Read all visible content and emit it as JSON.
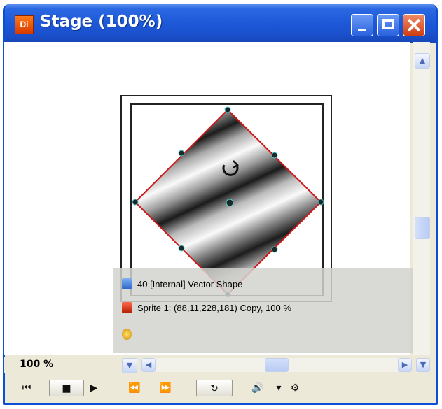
{
  "window": {
    "app_icon_text": "Di",
    "title": "Stage (100%)"
  },
  "info": {
    "line1": "40 [Internal] Vector Shape",
    "line2": "Sprite 1: (88,11,228,181) Copy, 100 %"
  },
  "status": {
    "zoom": "100 %"
  },
  "icons": {
    "minimize": "minimize-icon",
    "maximize": "maximize-icon",
    "close": "close-icon",
    "rotate": "rotate-icon",
    "rewind": "rewind-icon",
    "stop": "stop-icon",
    "play": "play-icon",
    "step_back": "step-back-icon",
    "step_forward": "step-forward-icon",
    "loop": "loop-icon",
    "volume": "volume-icon",
    "dtv": "dtv-icon"
  },
  "colors": {
    "title_bar": "#1d58d8",
    "close_button": "#cf3d12",
    "selection_outline": "#d01818"
  }
}
